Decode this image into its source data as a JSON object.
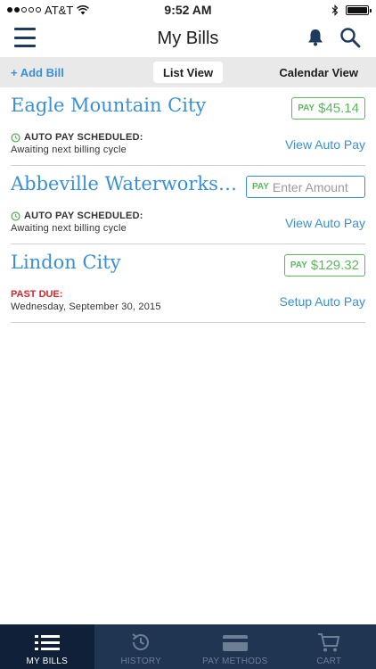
{
  "status_bar": {
    "carrier": "AT&T",
    "time": "9:52 AM"
  },
  "nav": {
    "title": "My Bills",
    "menu_icon": "hamburger-menu-icon",
    "bell_icon": "bell-icon",
    "search_icon": "search-icon"
  },
  "segment": {
    "add_bill": "+ Add Bill",
    "list_view": "List View",
    "calendar_view": "Calendar View"
  },
  "bills": [
    {
      "name": "Eagle Mountain City",
      "pay_tag": "PAY",
      "amount": "$45.14",
      "status": "AUTO PAY SCHEDULED:",
      "sub": "Awaiting next billing cycle",
      "action": "View Auto Pay"
    },
    {
      "name": "Abbeville Waterworks & Se...",
      "pay_tag": "PAY",
      "amount_placeholder": "Enter Amount",
      "status": "AUTO PAY SCHEDULED:",
      "sub": "Awaiting next billing cycle",
      "action": "View Auto Pay"
    },
    {
      "name": "Lindon City",
      "pay_tag": "PAY",
      "amount": "$129.32",
      "status": "PAST DUE:",
      "sub": "Wednesday, September 30, 2015",
      "action": "Setup Auto Pay"
    }
  ],
  "tabs": [
    {
      "label": "MY BILLS",
      "icon": "list-icon",
      "active": true
    },
    {
      "label": "HISTORY",
      "icon": "history-icon",
      "active": false
    },
    {
      "label": "PAY METHODS",
      "icon": "credit-card-icon",
      "active": false
    },
    {
      "label": "CART",
      "icon": "cart-icon",
      "active": false
    }
  ],
  "colors": {
    "accent_blue": "#3b8fd4",
    "pay_green": "#5cb85c",
    "past_due_red": "#d9262c",
    "tab_bar": "#1f3552"
  }
}
